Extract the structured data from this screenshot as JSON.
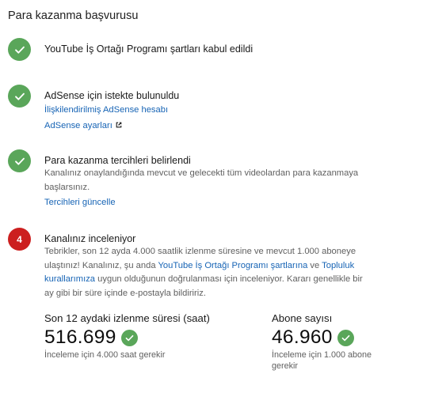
{
  "page": {
    "title": "Para kazanma başvurusu"
  },
  "steps": [
    {
      "title": "YouTube İş Ortağı Programı şartları kabul edildi"
    },
    {
      "title": "AdSense için istekte bulunuldu",
      "link1": "İlişkilendirilmiş AdSense hesabı",
      "link2": "AdSense ayarları",
      "link2_icon": "external-link-icon"
    },
    {
      "title": "Para kazanma tercihleri belirlendi",
      "desc_line1": "Kanalınız onaylandığında mevcut ve gelecekti tüm videolardan para kazanmaya",
      "desc_line2": "başlarsınız.",
      "link": "Tercihleri güncelle"
    },
    {
      "number": "4",
      "title": "Kanalınız inceleniyor",
      "desc_l1": "Tebrikler, son 12 ayda 4.000 saatlik izlenme süresine ve mevcut 1.000 aboneye",
      "desc_l2_a": "ulaştınız! Kanalınız, şu anda ",
      "desc_l2_link1": "YouTube İş Ortağı Programı şartlarına",
      "desc_l2_b": " ve ",
      "desc_l2_link2": "Topluluk",
      "desc_l3_link2": "kurallarımıza",
      "desc_l3_b": " uygun olduğunun doğrulanması için inceleniyor. Kararı genellikle bir",
      "desc_l4": "ay gibi bir süre içinde e-postayla bildiririz."
    }
  ],
  "stats": {
    "watch_time": {
      "label": "Son 12 aydaki izlenme süresi (saat)",
      "value": "516.699",
      "note": "İnceleme için 4.000 saat gerekir"
    },
    "subscribers": {
      "label": "Abone sayısı",
      "value": "46.960",
      "note_l1": "İnceleme için 1.000 abone",
      "note_l2": "gerekir"
    }
  },
  "colors": {
    "success": "#5aa65a",
    "pending": "#cc1f1f",
    "link": "#1764b5"
  },
  "icons": {
    "done": "check-icon"
  }
}
